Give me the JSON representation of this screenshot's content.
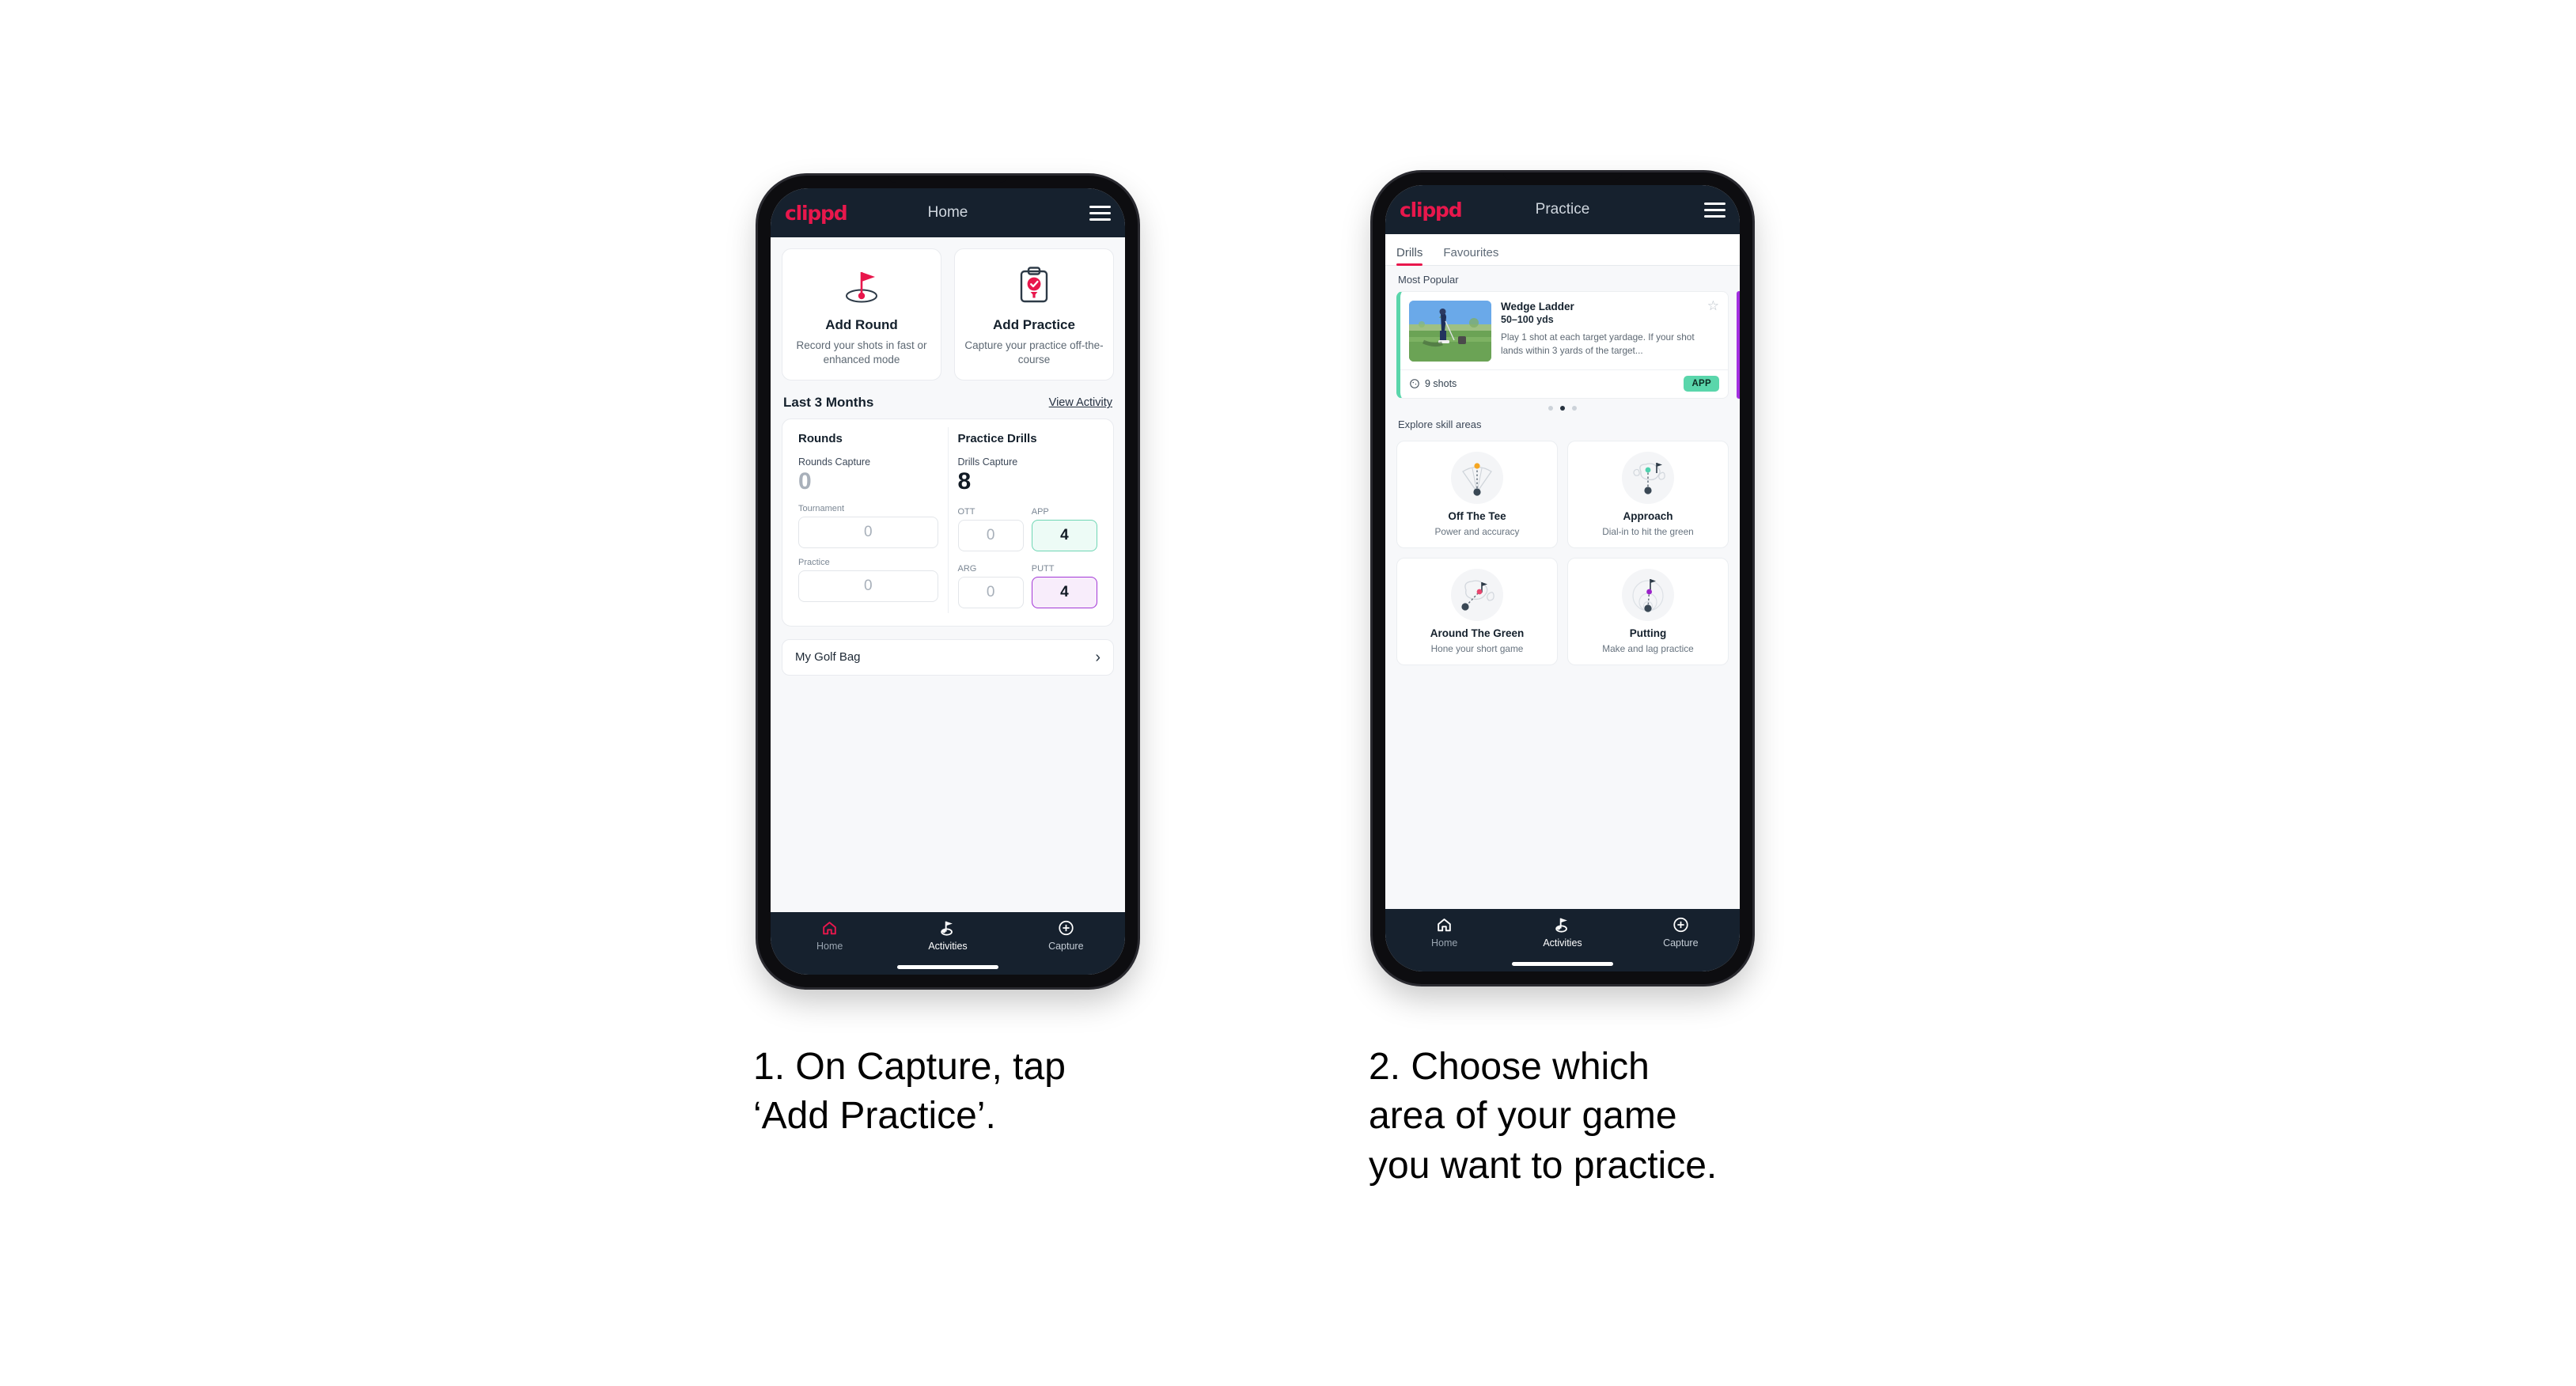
{
  "phone1": {
    "appbar": {
      "brand": "clippd",
      "title": "Home",
      "menu_icon": "hamburger-icon"
    },
    "actions": [
      {
        "icon": "golf-flag-hole-icon",
        "title": "Add Round",
        "subtitle": "Record your shots in fast or enhanced mode"
      },
      {
        "icon": "clipboard-check-tee-icon",
        "title": "Add Practice",
        "subtitle": "Capture your practice off-the-course"
      }
    ],
    "section": {
      "title": "Last 3 Months",
      "link": "View Activity"
    },
    "rounds": {
      "heading": "Rounds",
      "capture_label": "Rounds Capture",
      "capture_value": "0",
      "metrics": [
        {
          "label": "Tournament",
          "value": "0",
          "state": "empty"
        },
        {
          "label": "Practice",
          "value": "0",
          "state": "empty"
        }
      ]
    },
    "drills": {
      "heading": "Practice Drills",
      "capture_label": "Drills Capture",
      "capture_value": "8",
      "metrics": [
        {
          "label": "OTT",
          "value": "0",
          "state": "empty"
        },
        {
          "label": "APP",
          "value": "4",
          "state": "green"
        },
        {
          "label": "ARG",
          "value": "0",
          "state": "empty"
        },
        {
          "label": "PUTT",
          "value": "4",
          "state": "purple"
        }
      ]
    },
    "golf_bag": {
      "label": "My Golf Bag",
      "chevron": "chevron-right-icon"
    },
    "nav": [
      {
        "icon": "home-icon",
        "label": "Home",
        "active": false
      },
      {
        "icon": "golf-flag-icon",
        "label": "Activities",
        "active": true
      },
      {
        "icon": "plus-circle-icon",
        "label": "Capture",
        "active": false
      }
    ]
  },
  "phone2": {
    "appbar": {
      "brand": "clippd",
      "title": "Practice",
      "menu_icon": "hamburger-icon"
    },
    "tabs": [
      {
        "label": "Drills",
        "active": true
      },
      {
        "label": "Favourites",
        "active": false
      }
    ],
    "most_popular_label": "Most Popular",
    "drill_card": {
      "title": "Wedge Ladder",
      "yardage": "50–100 yds",
      "description": "Play 1 shot at each target yardage. If your shot lands within 3 yards of the target...",
      "shots": "9 shots",
      "shots_icon": "clock-icon",
      "badge": "APP",
      "star_icon": "star-outline-icon",
      "accent_color": "#5ad6ab",
      "next_card_accent": "#a22ee0"
    },
    "carousel_dots": {
      "count": 3,
      "active_index": 1
    },
    "explore_label": "Explore skill areas",
    "skills": [
      {
        "icon": "tee-shot-fan-icon",
        "title": "Off The Tee",
        "subtitle": "Power and accuracy",
        "dot_color": "#f5a623"
      },
      {
        "icon": "approach-green-icon",
        "title": "Approach",
        "subtitle": "Dial-in to hit the green",
        "dot_color": "#4fd1ae"
      },
      {
        "icon": "chip-green-icon",
        "title": "Around The Green",
        "subtitle": "Hone your short game",
        "dot_color": "#e8476f"
      },
      {
        "icon": "putting-rings-icon",
        "title": "Putting",
        "subtitle": "Make and lag practice",
        "dot_color": "#9b22c9"
      }
    ],
    "nav": [
      {
        "icon": "home-icon",
        "label": "Home",
        "active": false
      },
      {
        "icon": "golf-flag-icon",
        "label": "Activities",
        "active": true
      },
      {
        "icon": "plus-circle-icon",
        "label": "Capture",
        "active": false
      }
    ]
  },
  "captions": {
    "one": "1. On Capture, tap\n‘Add Practice’.",
    "two": "2. Choose which\narea of your game\nyou want to practice."
  },
  "colors": {
    "brand_pink": "#e8174c",
    "appbar_dark": "#16212e",
    "green_accent": "#5ad6ab",
    "purple_accent": "#a337d6"
  }
}
